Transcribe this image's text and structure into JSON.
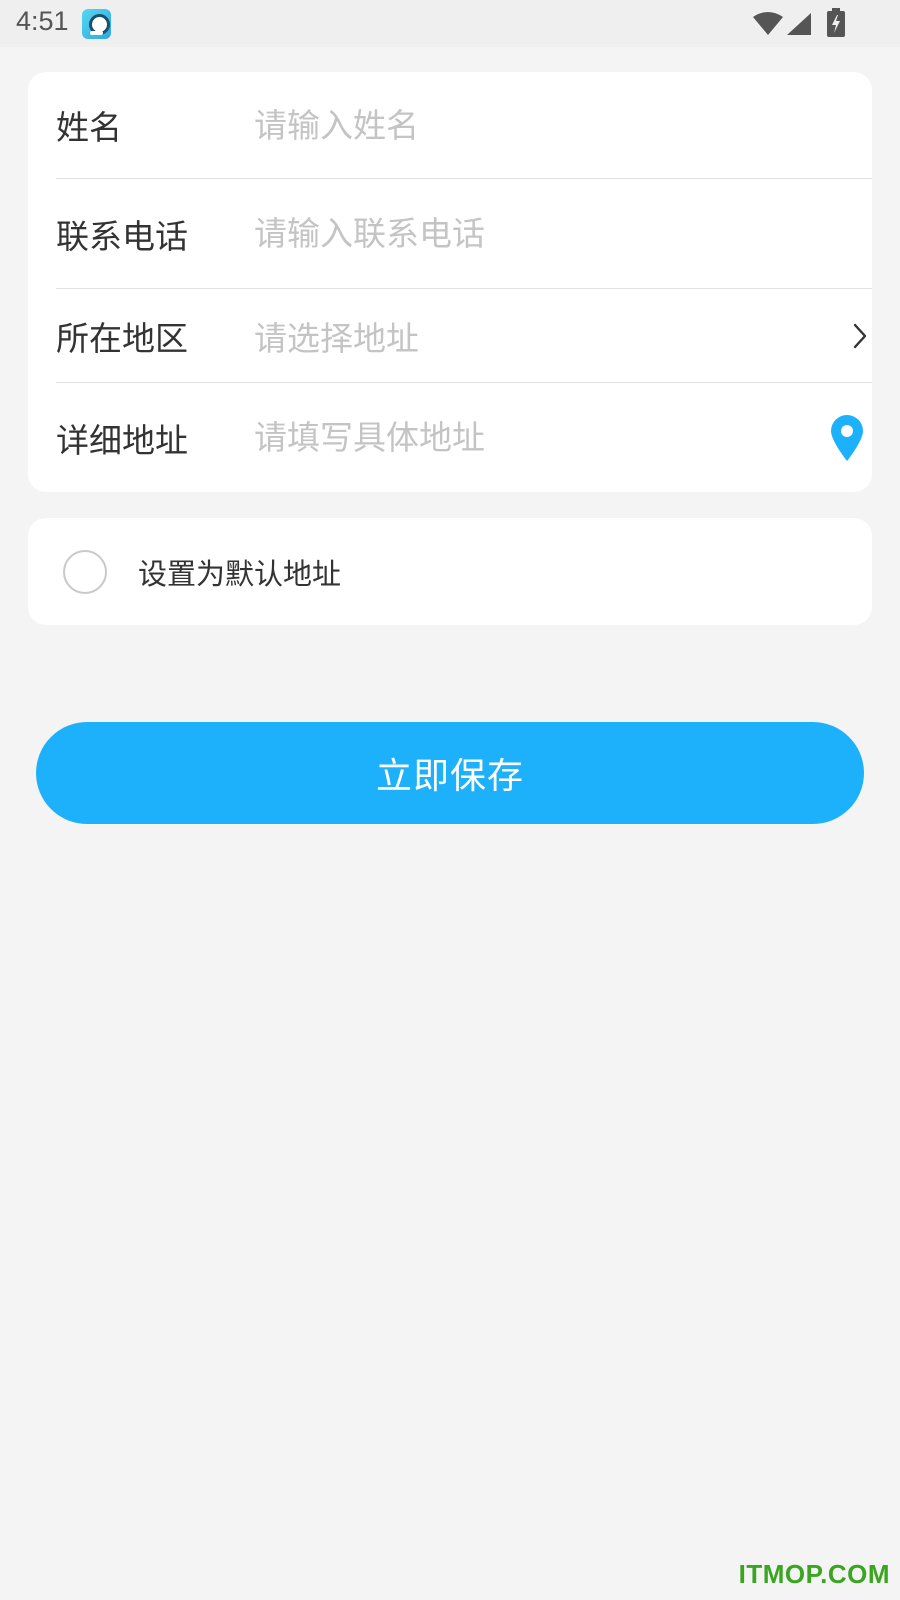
{
  "status_bar": {
    "time": "4:51",
    "app_icon": "camera-app-icon",
    "wifi_icon": "wifi-icon",
    "signal_icon": "cellular-signal-icon",
    "battery_icon": "battery-charging-icon"
  },
  "form": {
    "name": {
      "label": "姓名",
      "placeholder": "请输入姓名",
      "value": ""
    },
    "phone": {
      "label": "联系电话",
      "placeholder": "请输入联系电话",
      "value": ""
    },
    "region": {
      "label": "所在地区",
      "placeholder": "请选择地址",
      "icon": "chevron-right-icon"
    },
    "detail": {
      "label": "详细地址",
      "placeholder": "请填写具体地址",
      "value": "",
      "icon": "location-pin-icon"
    }
  },
  "default_address": {
    "label": "设置为默认地址",
    "checked": false
  },
  "save_button": {
    "label": "立即保存"
  },
  "watermark": {
    "text": "ITMOP.COM"
  },
  "colors": {
    "accent": "#1eb1fb",
    "background": "#f4f4f4",
    "card": "#ffffff",
    "label_text": "#333333",
    "placeholder_text": "#c4c4c4",
    "divider": "#e2e2e2",
    "watermark": "#3aa61f"
  }
}
